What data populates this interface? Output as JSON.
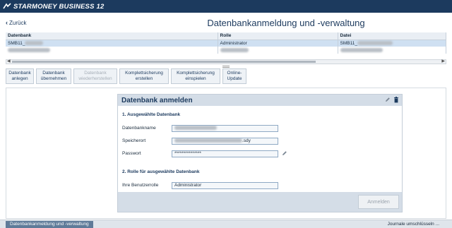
{
  "app": {
    "brand": "STARMONEY BUSINESS 12"
  },
  "header": {
    "back_label": "Zurück",
    "title": "Datenbankanmeldung und -verwaltung"
  },
  "table": {
    "columns": [
      "Datenbank",
      "Rolle",
      "Datei"
    ],
    "rows": [
      {
        "db": "SMB11_",
        "role": "Administrator",
        "file": "SMB11_"
      }
    ]
  },
  "toolbar": {
    "btn1": "Datenbank\nanlegen",
    "btn2": "Datenbank\nübernehmen",
    "btn3": "Datenbank\nwiederherstellen",
    "btn4": "Komplettsicherung\nerstellen",
    "btn5": "Komplettsicherung\neinspielen",
    "btn6": "Online-\nUpdate"
  },
  "panel": {
    "title": "Datenbank anmelden",
    "section1": "1. Ausgewählte Datenbank",
    "label_dbname": "Datenbankname",
    "label_location": "Speicherort",
    "location_suffix": ".sdy",
    "label_password": "Passwort",
    "password_value": "***************",
    "section2": "2. Rolle für ausgewählte Datenbank",
    "label_role": "Ihre Benutzerrolle",
    "role_value": "Administrator",
    "login_button": "Anmelden"
  },
  "status": {
    "tab": "Datenbankanmeldung und -verwaltung",
    "right": "Journale umschlüsseln ..."
  }
}
